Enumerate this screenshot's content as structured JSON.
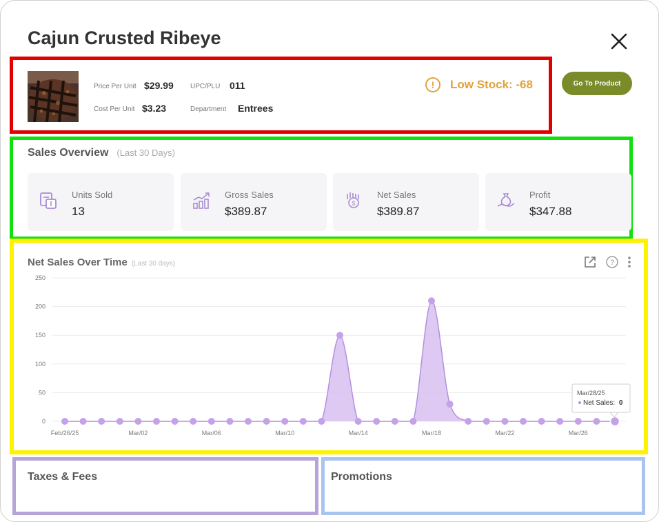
{
  "product": {
    "name": "Cajun Crusted Ribeye",
    "price_label": "Price Per Unit",
    "price": "$29.99",
    "upc_label": "UPC/PLU",
    "upc": "011",
    "cost_label": "Cost Per Unit",
    "cost": "$3.23",
    "department_label": "Department",
    "department": "Entrees",
    "stock_status": "Low Stock: -68",
    "goto_label": "Go To Product"
  },
  "sales_overview": {
    "title": "Sales Overview",
    "subtitle": "(Last 30 Days)",
    "stats": [
      {
        "label": "Units Sold",
        "value": "13",
        "icon": "units-icon"
      },
      {
        "label": "Gross Sales",
        "value": "$389.87",
        "icon": "chart-growth-icon"
      },
      {
        "label": "Net Sales",
        "value": "$389.87",
        "icon": "money-hand-icon"
      },
      {
        "label": "Profit",
        "value": "$347.88",
        "icon": "money-bag-hand-icon"
      }
    ]
  },
  "net_sales_chart": {
    "title": "Net Sales Over Time",
    "subtitle": "(Last 30 days)",
    "tooltip": {
      "date": "Mar/28/25",
      "label": "Net Sales:",
      "value": "0"
    }
  },
  "chart_data": {
    "type": "area",
    "title": "Net Sales Over Time",
    "ylim": [
      0,
      250
    ],
    "y_ticks": [
      0,
      50,
      100,
      150,
      200,
      250
    ],
    "x_tick_labels": [
      "Feb/26/25",
      "Mar/02",
      "Mar/06",
      "Mar/10",
      "Mar/14",
      "Mar/18",
      "Mar/22",
      "Mar/26"
    ],
    "x": [
      "Feb/26",
      "Feb/27",
      "Feb/28",
      "Mar/01",
      "Mar/02",
      "Mar/03",
      "Mar/04",
      "Mar/05",
      "Mar/06",
      "Mar/07",
      "Mar/08",
      "Mar/09",
      "Mar/10",
      "Mar/11",
      "Mar/12",
      "Mar/13",
      "Mar/14",
      "Mar/15",
      "Mar/16",
      "Mar/17",
      "Mar/18",
      "Mar/19",
      "Mar/20",
      "Mar/21",
      "Mar/22",
      "Mar/23",
      "Mar/24",
      "Mar/25",
      "Mar/26",
      "Mar/27",
      "Mar/28"
    ],
    "series": [
      {
        "name": "Net Sales",
        "values": [
          0,
          0,
          0,
          0,
          0,
          0,
          0,
          0,
          0,
          0,
          0,
          0,
          0,
          0,
          0,
          150,
          0,
          0,
          0,
          0,
          210,
          30,
          0,
          0,
          0,
          0,
          0,
          0,
          0,
          0,
          0
        ]
      }
    ],
    "grid": true,
    "color": "#c8a8e6"
  },
  "taxes": {
    "title": "Taxes & Fees"
  },
  "promotions": {
    "title": "Promotions"
  }
}
